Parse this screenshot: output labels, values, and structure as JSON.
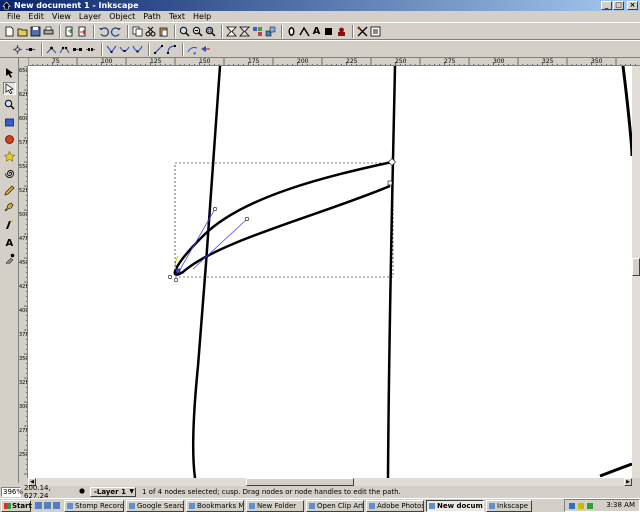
{
  "window": {
    "title": "New document 1 - Inkscape",
    "buttons": [
      "_",
      "□",
      "×"
    ]
  },
  "menubar": [
    "File",
    "Edit",
    "View",
    "Layer",
    "Object",
    "Path",
    "Text",
    "Help"
  ],
  "toolbar_text_buttons": [
    "A"
  ],
  "ruler": {
    "h_labels": [
      "75",
      "100",
      "125",
      "150",
      "175",
      "200",
      "225",
      "250",
      "275",
      "300",
      "325",
      "350"
    ],
    "v_labels": [
      "650",
      "625",
      "600",
      "575",
      "550",
      "525",
      "500",
      "475",
      "450",
      "425",
      "400",
      "375",
      "350",
      "325",
      "300",
      "275",
      "250"
    ]
  },
  "statusbar": {
    "zoom": "396%",
    "coords": "200.14, 627.24",
    "layer": "-Layer 1",
    "message": "1 of 4 nodes selected; cusp. Drag nodes or node handles to edit the path."
  },
  "taskbar": {
    "start": "Start",
    "tasks": [
      {
        "label": "Stomp RecordNo...",
        "active": false
      },
      {
        "label": "Google Search: p...",
        "active": false
      },
      {
        "label": "Bookmarks Manager",
        "active": false
      },
      {
        "label": "New Folder",
        "active": false
      },
      {
        "label": "Open Clip Art Libr...",
        "active": false
      },
      {
        "label": "Adobe Photoshop",
        "active": false
      },
      {
        "label": "New document ...",
        "active": true
      },
      {
        "label": "Inkscape",
        "active": false
      }
    ],
    "clock": "3:38 AM"
  },
  "colors": {
    "title_start": "#0a246a",
    "title_end": "#a6caf0",
    "chrome": "#d4d0c8",
    "handle_line": "#4a4aff"
  }
}
